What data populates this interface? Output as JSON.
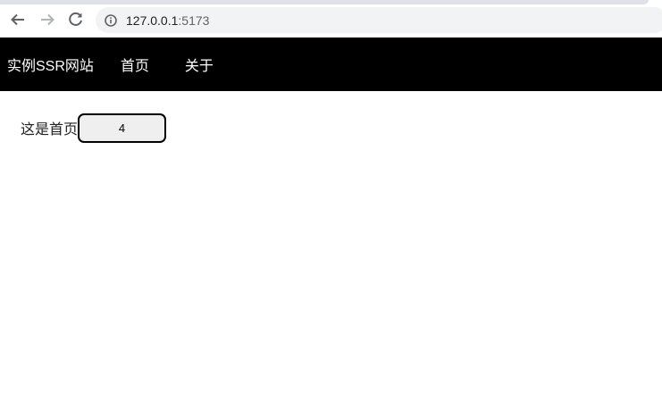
{
  "browser": {
    "back_icon": "arrow-left-icon",
    "forward_icon": "arrow-right-icon",
    "reload_icon": "reload-icon",
    "info_icon": "info-icon",
    "url_host": "127.0.0.1",
    "url_port": ":5173"
  },
  "site_nav": {
    "brand": "实例SSR网站",
    "links": [
      {
        "label": "首页"
      },
      {
        "label": "关于"
      }
    ],
    "background": "#000000",
    "text_color": "#ffffff"
  },
  "main": {
    "text": "这是首页",
    "counter_value": "4"
  }
}
